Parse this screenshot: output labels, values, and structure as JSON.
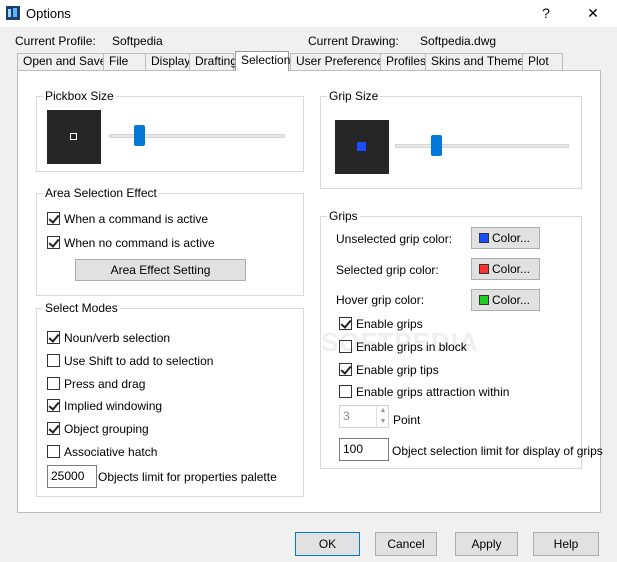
{
  "window": {
    "title": "Options",
    "help": "?",
    "close": "✕",
    "icon": "app-icon"
  },
  "header": {
    "profile_label": "Current Profile:",
    "profile_value": "Softpedia",
    "drawing_label": "Current Drawing:",
    "drawing_value": "Softpedia.dwg"
  },
  "tabs": [
    {
      "label": "Open and Save"
    },
    {
      "label": "File"
    },
    {
      "label": "Display"
    },
    {
      "label": "Drafting"
    },
    {
      "label": "Selection",
      "active": true
    },
    {
      "label": "User Preferences"
    },
    {
      "label": "Profiles"
    },
    {
      "label": "Skins and Themes"
    },
    {
      "label": "Plot"
    }
  ],
  "pickbox": {
    "title": "Pickbox Size",
    "slider_value": 0.15
  },
  "grip_size": {
    "title": "Grip Size",
    "slider_value": 0.22,
    "grip_color": "#1a4fff"
  },
  "area_selection": {
    "title": "Area Selection Effect",
    "options": [
      {
        "label": "When a command is active",
        "checked": true
      },
      {
        "label": "When no command is active",
        "checked": true
      }
    ],
    "button": "Area Effect Setting"
  },
  "select_modes": {
    "title": "Select Modes",
    "options": [
      {
        "label": "Noun/verb selection",
        "checked": true
      },
      {
        "label": "Use Shift to add to selection",
        "checked": false
      },
      {
        "label": "Press and drag",
        "checked": false
      },
      {
        "label": "Implied windowing",
        "checked": true
      },
      {
        "label": "Object grouping",
        "checked": true
      },
      {
        "label": "Associative hatch",
        "checked": false
      }
    ],
    "limit_value": "25000",
    "limit_label": "Objects limit for properties palette"
  },
  "grips": {
    "title": "Grips",
    "colors": [
      {
        "label": "Unselected grip color:",
        "button": "Color...",
        "color": "#1a4fff"
      },
      {
        "label": "Selected grip color:",
        "button": "Color...",
        "color": "#ff3030"
      },
      {
        "label": "Hover grip color:",
        "button": "Color...",
        "color": "#22cc22"
      }
    ],
    "options": [
      {
        "label": "Enable grips",
        "checked": true
      },
      {
        "label": "Enable grips in block",
        "checked": false
      },
      {
        "label": "Enable grip tips",
        "checked": true
      },
      {
        "label": "Enable grips attraction within",
        "checked": false
      }
    ],
    "point_value": "3",
    "point_label": "Point",
    "limit_value": "100",
    "limit_label": "Object selection limit for display of grips"
  },
  "footer": {
    "ok": "OK",
    "cancel": "Cancel",
    "apply": "Apply",
    "help": "Help"
  },
  "watermark": "SOFTPEDIA"
}
